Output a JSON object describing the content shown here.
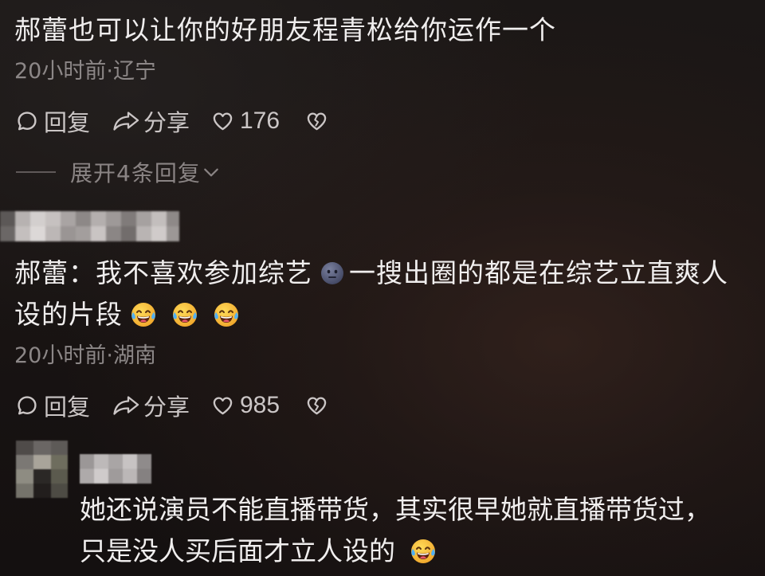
{
  "theme": {
    "text": "#f0eeee",
    "meta_text": "#8c8787",
    "action_text": "#cbc6c6",
    "expand_text": "#8a8484"
  },
  "icons": {
    "reply": "speech-bubble-icon",
    "share": "share-arrow-icon",
    "like": "heart-icon",
    "dislike": "broken-heart-icon",
    "expand": "chevron-down-icon"
  },
  "comments": [
    {
      "text": "郝蕾也可以让你的好朋友程青松给你运作一个",
      "meta": "20小时前·辽宁",
      "reply_label": "回复",
      "share_label": "分享",
      "like_count": "176",
      "expand_replies": "展开4条回复"
    },
    {
      "line1_text_a": "郝蕾：我不喜欢参加综艺",
      "line1_emoji": "speechless-face-emoji",
      "line1_text_b": "一搜出圈的都是在综艺立直爽人",
      "line2_text": "设的片段",
      "line2_emojis": [
        "tears-of-joy-emoji",
        "tears-of-joy-emoji",
        "tears-of-joy-emoji"
      ],
      "meta": "20小时前·湖南",
      "reply_label": "回复",
      "share_label": "分享",
      "like_count": "985"
    }
  ],
  "reply": {
    "line1_text": "她还说演员不能直播带货，其实很早她就直播带货过，",
    "line2_text": "只是没人买后面才立人设的",
    "line2_emoji": "tears-of-joy-emoji"
  }
}
